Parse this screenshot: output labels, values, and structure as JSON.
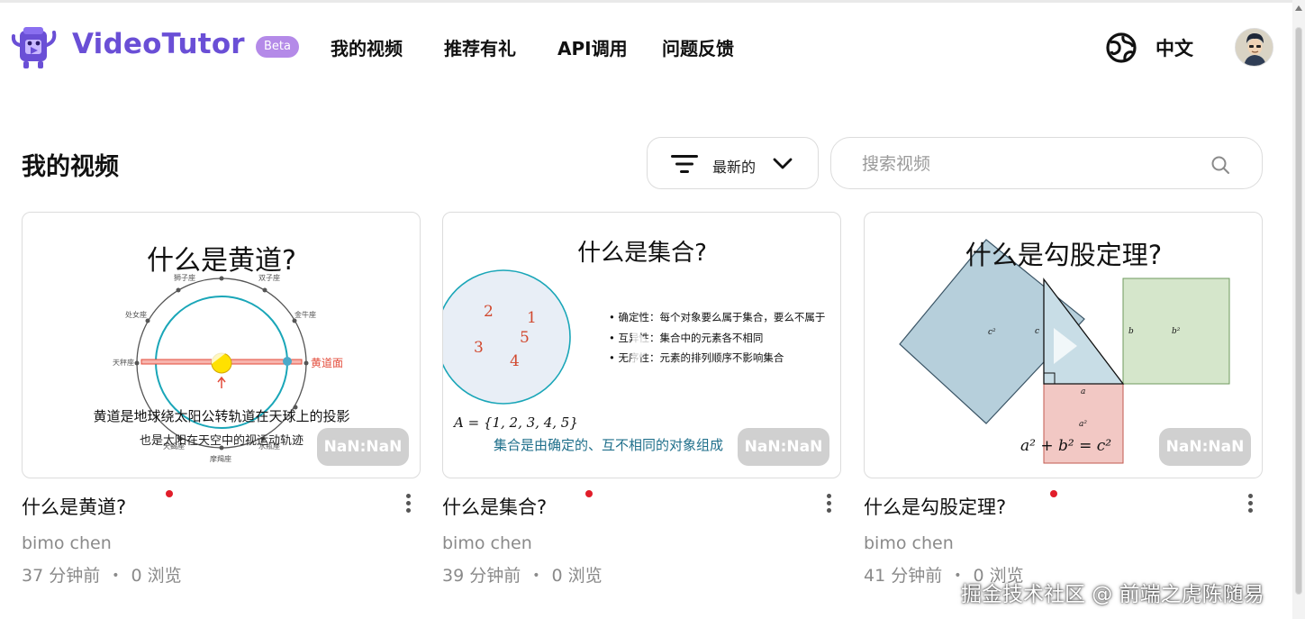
{
  "header": {
    "brand": "VideoTutor",
    "beta": "Beta",
    "nav": [
      {
        "label": "我的视频"
      },
      {
        "label": "推荐有礼"
      },
      {
        "label": "API调用"
      },
      {
        "label": "问题反馈"
      }
    ],
    "language": "中文",
    "language_icon": "globe-icon",
    "avatar_icon": "user-avatar"
  },
  "main": {
    "title": "我的视频",
    "sort": {
      "label": "最新的",
      "icon": "filter-icon"
    },
    "search": {
      "placeholder": "搜索视频",
      "value": "",
      "icon": "search-icon"
    }
  },
  "videos": [
    {
      "title": "什么是黄道?",
      "author": "bimo chen",
      "time": "37 分钟前",
      "views": "0 浏览",
      "duration": "NaN:NaN",
      "thumb": {
        "heading": "什么是黄道?",
        "caption1": "黄道是地球绕太阳公转轨道在天球上的投影",
        "caption2": "也是太阳在天空中的视运动轨迹",
        "ecliptic_label": "黄道面",
        "signs": [
          "狮子座",
          "双子座",
          "处女座",
          "金牛座",
          "天秤座",
          "天蝎座",
          "摩羯座",
          "水瓶座"
        ]
      }
    },
    {
      "title": "什么是集合?",
      "author": "bimo chen",
      "time": "39 分钟前",
      "views": "0 浏览",
      "duration": "NaN:NaN",
      "thumb": {
        "heading": "什么是集合?",
        "elements": [
          "2",
          "1",
          "5",
          "3",
          "4"
        ],
        "bullets": [
          "• 确定性：每个对象要么属于集合，要么不属于",
          "• 互异性：集合中的元素各不相同",
          "• 无序性：元素的排列顺序不影响集合"
        ],
        "formula": "A = {1, 2, 3, 4, 5}",
        "caption": "集合是由确定的、互不相同的对象组成"
      }
    },
    {
      "title": "什么是勾股定理?",
      "author": "bimo chen",
      "time": "41 分钟前",
      "views": "0 浏览",
      "duration": "NaN:NaN",
      "thumb": {
        "heading": "什么是勾股定理?",
        "label_c2": "c²",
        "label_c": "c",
        "label_b": "b",
        "label_b2": "b²",
        "label_a": "a",
        "label_a2": "a²",
        "formula": "a² + b² = c²"
      }
    }
  ],
  "watermark": "掘金技术社区 @ 前端之虎陈随易",
  "colors": {
    "brand": "#6a4fd6",
    "beta": "#b48ae8",
    "new_dot": "#e11d2a"
  }
}
